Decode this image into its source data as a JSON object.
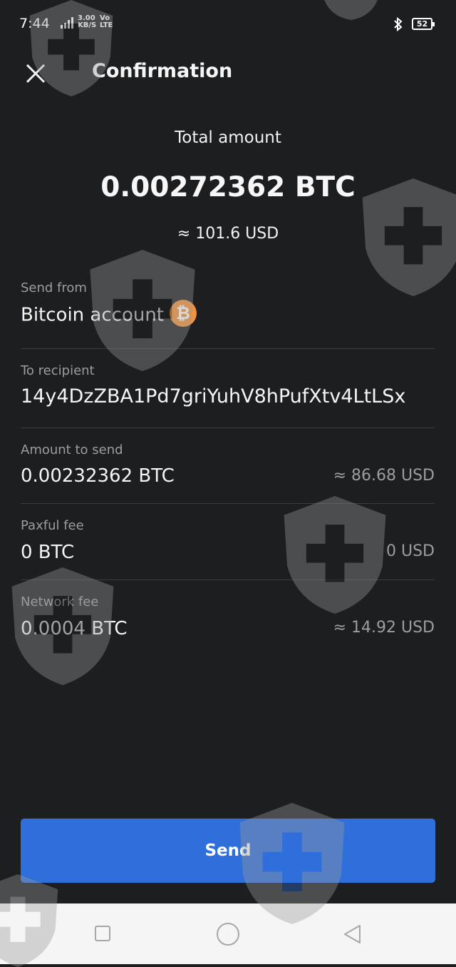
{
  "status_bar": {
    "time": "7:44",
    "network": "4G",
    "speed": "3.00",
    "speed_unit": "KB/S",
    "volte_top": "Vo",
    "volte_bottom": "LTE",
    "battery": "52"
  },
  "header": {
    "title": "Confirmation",
    "close_icon": "close-icon"
  },
  "summary": {
    "total_label": "Total amount",
    "total_btc": "0.00272362 BTC",
    "total_usd": "≈ 101.6 USD"
  },
  "details": {
    "send_from": {
      "label": "Send from",
      "value": "Bitcoin account",
      "icon": "bitcoin-icon",
      "icon_glyph": "₿"
    },
    "recipient": {
      "label": "To recipient",
      "value": "14y4DzZBA1Pd7griYuhV8hPufXtv4LtLSx"
    },
    "amount": {
      "label": "Amount to send",
      "value": "0.00232362 BTC",
      "usd": "≈ 86.68 USD"
    },
    "paxful_fee": {
      "label": "Paxful fee",
      "value": "0 BTC",
      "usd": "0 USD"
    },
    "network_fee": {
      "label": "Network fee",
      "value": "0.0004 BTC",
      "usd": "≈ 14.92 USD"
    }
  },
  "actions": {
    "send_label": "Send"
  },
  "colors": {
    "background": "#1d1e20",
    "accent": "#2f6fdb",
    "bitcoin": "#f2923a",
    "muted": "#9b9d9f"
  }
}
